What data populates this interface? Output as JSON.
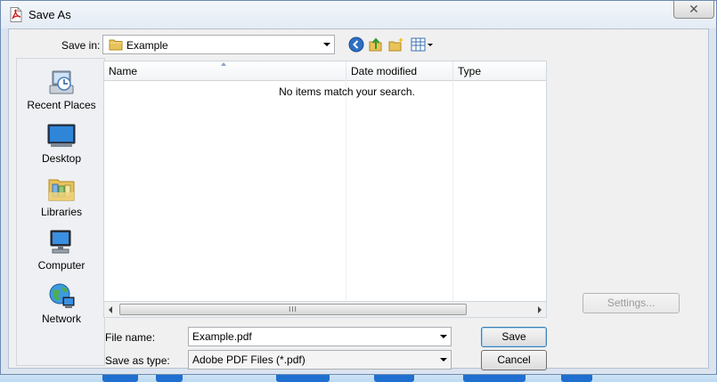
{
  "window": {
    "title": "Save As",
    "close_glyph": "✕"
  },
  "toolbar": {
    "save_in_label": "Save in:",
    "save_in_value": "Example",
    "back_icon": "back-arrow-icon",
    "up_icon": "up-folder-icon",
    "new_folder_icon": "new-folder-icon",
    "view_menu_icon": "view-menu-icon"
  },
  "places": [
    {
      "label": "Recent Places",
      "icon": "recent-places-icon"
    },
    {
      "label": "Desktop",
      "icon": "desktop-icon"
    },
    {
      "label": "Libraries",
      "icon": "libraries-icon"
    },
    {
      "label": "Computer",
      "icon": "computer-icon"
    },
    {
      "label": "Network",
      "icon": "network-icon"
    }
  ],
  "file_list": {
    "columns": [
      "Name",
      "Date modified",
      "Type"
    ],
    "empty_message": "No items match your search.",
    "scroll_grip": "III"
  },
  "form": {
    "file_name_label": "File name:",
    "file_name_value": "Example.pdf",
    "save_as_type_label": "Save as type:",
    "save_as_type_value": "Adobe PDF Files (*.pdf)"
  },
  "buttons": {
    "save": "Save",
    "cancel": "Cancel",
    "settings": "Settings..."
  },
  "colors": {
    "accent": "#3c7fb1",
    "desktop_background": "#2a8fd8",
    "disabled_text": "#9a9a9a"
  }
}
